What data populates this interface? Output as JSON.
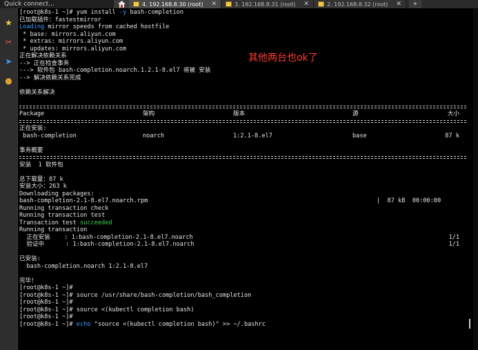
{
  "topbar": {
    "quick_connect": "Quick connect...",
    "tabs": [
      {
        "label": "4. 192.168.8.30 (root)",
        "active": true
      },
      {
        "label": "3. 192.168.8.31 (root)",
        "active": false
      },
      {
        "label": "2. 192.168.8.32 (root)",
        "active": false
      }
    ],
    "close_glyph": "✕",
    "new_tab_glyph": "+"
  },
  "sidebar": {
    "icons": [
      {
        "name": "star-icon",
        "glyph": "★",
        "color": "#f2c94c"
      },
      {
        "name": "tools-icon",
        "glyph": "✂",
        "color": "#e0524a"
      },
      {
        "name": "send-icon",
        "glyph": "➤",
        "color": "#3b9bff"
      },
      {
        "name": "dot-icon",
        "glyph": "●",
        "color": "#e0a030"
      }
    ]
  },
  "annotation": "其他两台也ok了",
  "terminal": {
    "lines": [
      {
        "t": "text",
        "segs": [
          {
            "s": "[root@k8s-1 ~]# yum install "
          },
          {
            "s": "-y",
            "c": "blue"
          },
          {
            "s": " bash-completion"
          }
        ]
      },
      {
        "t": "text",
        "segs": [
          {
            "s": "已加载插件：fastestmirror"
          }
        ]
      },
      {
        "t": "text",
        "segs": [
          {
            "s": "Loading",
            "c": "blue"
          },
          {
            "s": " mirror speeds from cached hostfile"
          }
        ]
      },
      {
        "t": "text",
        "segs": [
          {
            "s": " * base: mirrors.aliyun.com"
          }
        ]
      },
      {
        "t": "text",
        "segs": [
          {
            "s": " * extras: mirrors.aliyun.com"
          }
        ]
      },
      {
        "t": "text",
        "segs": [
          {
            "s": " * updates: mirrors.aliyun.com"
          }
        ]
      },
      {
        "t": "text",
        "segs": [
          {
            "s": "正在解决依赖关系"
          }
        ]
      },
      {
        "t": "text",
        "segs": [
          {
            "s": "--> 正在检查事务"
          }
        ]
      },
      {
        "t": "text",
        "segs": [
          {
            "s": "---> 软件包 bash-completion.noarch.1.2.1-8.el7 将被 安装"
          }
        ]
      },
      {
        "t": "text",
        "segs": [
          {
            "s": "--> 解决依赖关系完成"
          }
        ]
      },
      {
        "t": "blank"
      },
      {
        "t": "text",
        "segs": [
          {
            "s": "依赖关系解决"
          }
        ]
      },
      {
        "t": "blank"
      },
      {
        "t": "dashes"
      },
      {
        "t": "cols",
        "cells": [
          "Package",
          "架构",
          "版本",
          "源",
          "大小"
        ]
      },
      {
        "t": "dashes"
      },
      {
        "t": "text",
        "segs": [
          {
            "s": "正在安装:"
          }
        ]
      },
      {
        "t": "cols",
        "cells": [
          " bash-completion",
          "noarch",
          "1:2.1-8.el7",
          "base",
          "87 k"
        ]
      },
      {
        "t": "blank"
      },
      {
        "t": "text",
        "segs": [
          {
            "s": "事务概要"
          }
        ]
      },
      {
        "t": "dashes"
      },
      {
        "t": "text",
        "segs": [
          {
            "s": "安装  1 软件包"
          }
        ]
      },
      {
        "t": "blank"
      },
      {
        "t": "text",
        "segs": [
          {
            "s": "总下载量：87 k"
          }
        ]
      },
      {
        "t": "text",
        "segs": [
          {
            "s": "安装大小：263 k"
          }
        ]
      },
      {
        "t": "text",
        "segs": [
          {
            "s": "Downloading packages:"
          }
        ]
      },
      {
        "t": "dl",
        "left": "bash-completion-2.1-8.el7.noarch.rpm",
        "right": "|  87 kB  00:00:00"
      },
      {
        "t": "text",
        "segs": [
          {
            "s": "Running transaction check"
          }
        ]
      },
      {
        "t": "text",
        "segs": [
          {
            "s": "Running transaction test"
          }
        ]
      },
      {
        "t": "text",
        "segs": [
          {
            "s": "Transaction test "
          },
          {
            "s": "succeeded",
            "c": "green"
          }
        ]
      },
      {
        "t": "text",
        "segs": [
          {
            "s": "Running transaction"
          }
        ]
      },
      {
        "t": "prog",
        "left": "  正在安装    : 1:bash-completion-2.1-8.el7.noarch",
        "right": "1/1"
      },
      {
        "t": "prog",
        "left": "  验证中      : 1:bash-completion-2.1-8.el7.noarch",
        "right": "1/1"
      },
      {
        "t": "blank"
      },
      {
        "t": "text",
        "segs": [
          {
            "s": "已安装:"
          }
        ]
      },
      {
        "t": "text",
        "segs": [
          {
            "s": "  bash-completion.noarch 1:2.1-8.el7"
          }
        ]
      },
      {
        "t": "blank"
      },
      {
        "t": "text",
        "segs": [
          {
            "s": "完毕！"
          }
        ]
      },
      {
        "t": "text",
        "segs": [
          {
            "s": "[root@k8s-1 ~]#"
          }
        ]
      },
      {
        "t": "text",
        "segs": [
          {
            "s": "[root@k8s-1 ~]# source /usr/share/bash-completion/bash_completion"
          }
        ]
      },
      {
        "t": "text",
        "segs": [
          {
            "s": "[root@k8s-1 ~]#"
          }
        ]
      },
      {
        "t": "text",
        "segs": [
          {
            "s": "[root@k8s-1 ~]# source <(kubectl completion bash)"
          }
        ]
      },
      {
        "t": "text",
        "segs": [
          {
            "s": "[root@k8s-1 ~]#"
          }
        ]
      },
      {
        "t": "text",
        "segs": [
          {
            "s": "[root@k8s-1 ~]# "
          },
          {
            "s": "echo",
            "c": "blue"
          },
          {
            "s": " \"source <(kubectl completion bash)\" >> ~/.bashrc"
          }
        ]
      }
    ]
  }
}
